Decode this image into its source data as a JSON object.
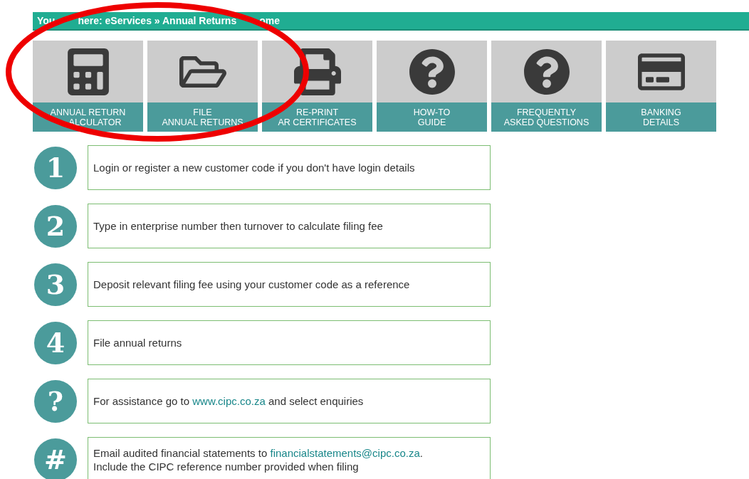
{
  "breadcrumb": [
    "You",
    "here: eServices » Annual Returns",
    "ome"
  ],
  "tiles": [
    {
      "line1": "ANNUAL RETURN",
      "line2": "ALCULATOR"
    },
    {
      "line1": "FILE",
      "line2": "ANNUAL RETURNS"
    },
    {
      "line1": "RE-PRINT",
      "line2": "AR CERTIFICATES"
    },
    {
      "line1": "HOW-TO",
      "line2": "GUIDE"
    },
    {
      "line1": "FREQUENTLY",
      "line2": "ASKED QUESTIONS"
    },
    {
      "line1": "BANKING",
      "line2": "DETAILS"
    }
  ],
  "steps": [
    {
      "badge": "1",
      "text": "Login or register a new customer code if you don't have login details"
    },
    {
      "badge": "2",
      "text": "Type in enterprise number then turnover to calculate filing fee"
    },
    {
      "badge": "3",
      "text": "Deposit relevant filing fee using your customer code as a reference"
    },
    {
      "badge": "4",
      "text": "File annual returns"
    },
    {
      "badge": "?",
      "text": "For assistance go to ",
      "link": "www.cipc.co.za",
      "after": " and select enquiries"
    },
    {
      "badge": "#",
      "text": "Email audited financial statements to ",
      "link": "financialstatements@cipc.co.za",
      "after": ".",
      "line2": "Include the CIPC reference number provided when filing"
    }
  ]
}
